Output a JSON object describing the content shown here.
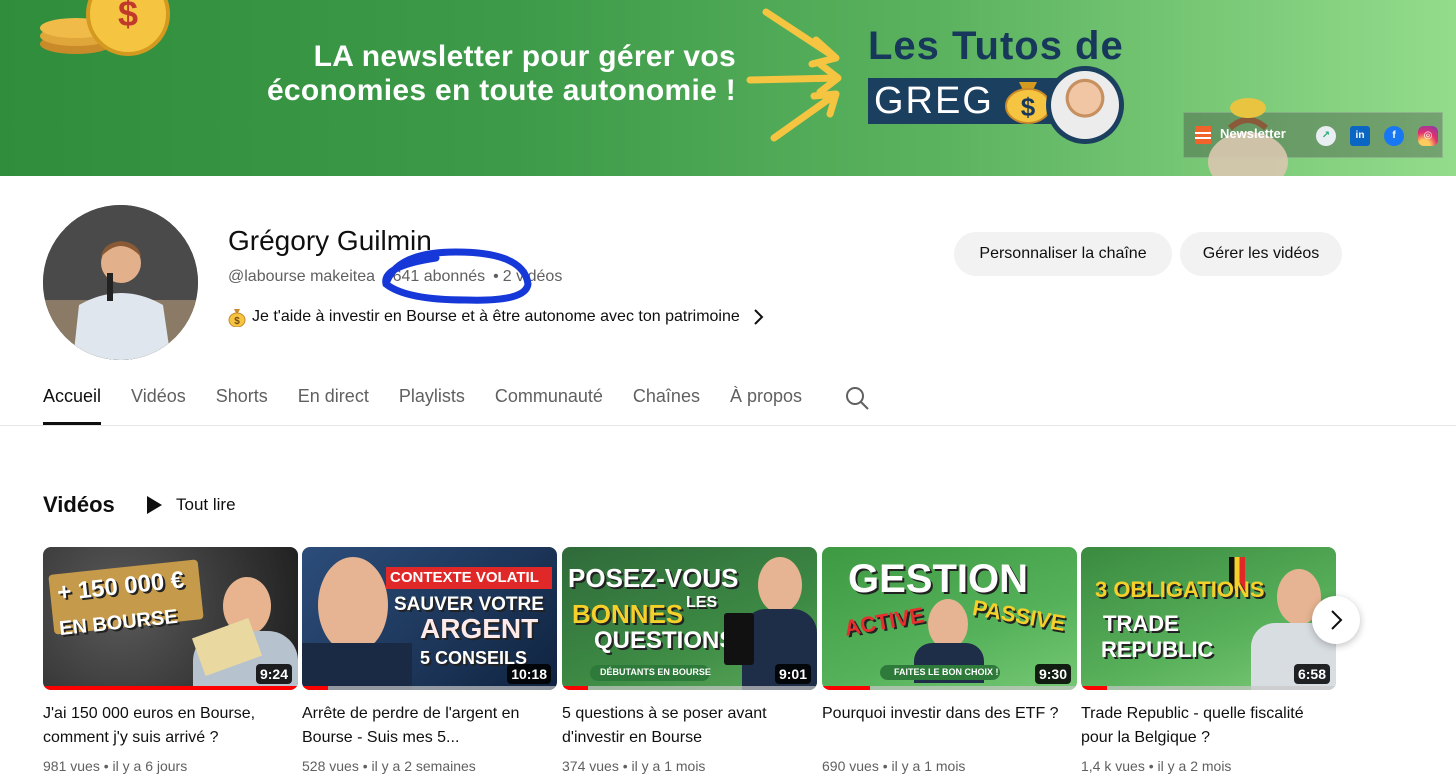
{
  "banner": {
    "tagline_line1": "LA newsletter pour gérer vos",
    "tagline_line2": "économies en toute autonomie !",
    "brand_title": "Les Tutos de",
    "brand_name": "GREG",
    "newsletter_label": "Newsletter",
    "social_icons": [
      "chart-icon",
      "linkedin-icon",
      "facebook-icon",
      "instagram-icon"
    ],
    "colors": {
      "green_dark": "#2f8d3c",
      "green_light": "#93dc8c",
      "navy": "#1b3f5e",
      "yellow": "#f5c542"
    }
  },
  "channel": {
    "name": "Grégory Guilmin",
    "handle": "@labourse makeitea",
    "subscribers": "641 abonnés",
    "videos_count": "2 vidéos",
    "description": "Je t'aide à investir en Bourse et à être autonome avec ton patrimoine"
  },
  "actions": {
    "customize_label": "Personnaliser la chaîne",
    "manage_label": "Gérer les vidéos"
  },
  "tabs": [
    "Accueil",
    "Vidéos",
    "Shorts",
    "En direct",
    "Playlists",
    "Communauté",
    "Chaînes",
    "À propos"
  ],
  "active_tab": "Accueil",
  "section": {
    "title": "Vidéos",
    "play_all_label": "Tout lire"
  },
  "videos": [
    {
      "title": "J'ai 150 000 euros en Bourse, comment j'y suis arrivé ?",
      "views": "981 vues",
      "age": "il y a 6 jours",
      "duration": "9:24",
      "thumb_text1": "+ 150 000 €",
      "thumb_text2": "EN BOURSE",
      "watched_progress": 1.0
    },
    {
      "title": "Arrête de perdre de l'argent en Bourse - Suis mes 5...",
      "views": "528 vues",
      "age": "il y a 2 semaines",
      "duration": "10:18",
      "thumb_text1": "CONTEXTE VOLATIL",
      "thumb_text2": "SAUVER VOTRE",
      "thumb_text3": "ARGENT",
      "thumb_text4": "5 CONSEILS",
      "watched_progress": 0.1
    },
    {
      "title": "5 questions à se poser avant d'investir en Bourse",
      "views": "374 vues",
      "age": "il y a 1 mois",
      "duration": "9:01",
      "thumb_text1": "POSEZ-VOUS",
      "thumb_text2": "LES",
      "thumb_text3": "BONNES",
      "thumb_text4": "QUESTIONS",
      "thumb_text5": "DÉBUTANTS EN BOURSE",
      "watched_progress": 0.1
    },
    {
      "title": "Pourquoi investir dans des ETF ?",
      "views": "690 vues",
      "age": "il y a 1 mois",
      "duration": "9:30",
      "thumb_text1": "GESTION",
      "thumb_text2": "ACTIVE",
      "thumb_text3": "PASSIVE",
      "thumb_text4": "FAITES LE BON CHOIX !",
      "watched_progress": 0.19
    },
    {
      "title": "Trade Republic - quelle fiscalité pour la Belgique ?",
      "views": "1,4 k vues",
      "age": "il y a 2 mois",
      "duration": "6:58",
      "thumb_text1": "3 OBLIGATIONS",
      "thumb_text2": "TRADE",
      "thumb_text3": "REPUBLIC",
      "watched_progress": 0.1
    }
  ]
}
